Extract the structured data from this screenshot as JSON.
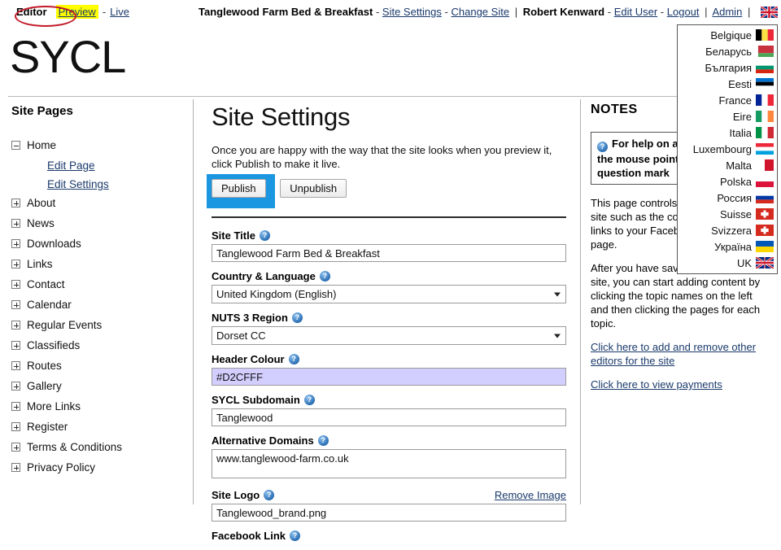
{
  "topbar": {
    "editor": "Editor",
    "preview": "Preview",
    "dash": "-",
    "live": "Live",
    "site_name": "Tanglewood Farm Bed & Breakfast",
    "dash2": "-",
    "site_settings": "Site Settings",
    "dash3": "-",
    "change_site": "Change Site",
    "pipe1": "|",
    "user_name": "Robert Kenward",
    "dash4": "-",
    "edit_user": "Edit User",
    "dash5": "-",
    "logout": "Logout",
    "pipe2": "|",
    "admin": "Admin",
    "pipe3": "|",
    "flag_icon": "uk-flag-icon"
  },
  "brand": {
    "logo_text": "SYCL"
  },
  "sidebar": {
    "heading": "Site Pages",
    "items": [
      {
        "label": "Home",
        "state": "expanded"
      },
      {
        "label": "About",
        "state": "collapsed"
      },
      {
        "label": "News",
        "state": "collapsed"
      },
      {
        "label": "Downloads",
        "state": "collapsed"
      },
      {
        "label": "Links",
        "state": "collapsed"
      },
      {
        "label": "Contact",
        "state": "collapsed"
      },
      {
        "label": "Calendar",
        "state": "collapsed"
      },
      {
        "label": "Regular Events",
        "state": "collapsed"
      },
      {
        "label": "Classifieds",
        "state": "collapsed"
      },
      {
        "label": "Routes",
        "state": "collapsed"
      },
      {
        "label": "Gallery",
        "state": "collapsed"
      },
      {
        "label": "More Links",
        "state": "collapsed"
      },
      {
        "label": "Register",
        "state": "collapsed"
      },
      {
        "label": "Terms & Conditions",
        "state": "collapsed"
      },
      {
        "label": "Privacy Policy",
        "state": "collapsed"
      }
    ],
    "home_sub": [
      {
        "label": "Edit Page"
      },
      {
        "label": "Edit Settings"
      }
    ]
  },
  "main": {
    "title": "Site Settings",
    "intro": "Once you are happy with the way that the site looks when you preview it, click Publish to make it live.",
    "publish_label": "Publish",
    "unpublish_label": "Unpublish",
    "fields": {
      "site_title": {
        "label": "Site Title",
        "value": "Tanglewood Farm Bed & Breakfast"
      },
      "country_language": {
        "label": "Country & Language",
        "value": "United Kingdom (English)"
      },
      "nuts3": {
        "label": "NUTS 3 Region",
        "value": "Dorset CC"
      },
      "header_colour": {
        "label": "Header Colour",
        "value": "#D2CFFF"
      },
      "sycl_subdomain": {
        "label": "SYCL Subdomain",
        "value": "Tanglewood"
      },
      "alternative_domains": {
        "label": "Alternative Domains",
        "value": "www.tanglewood-farm.co.uk"
      },
      "site_logo": {
        "label": "Site Logo",
        "value": "Tanglewood_brand.png",
        "remove_link": "Remove Image"
      },
      "facebook_link": {
        "label": "Facebook Link"
      }
    }
  },
  "notes": {
    "heading": "NOTES",
    "helpbox": "For help on any item, hold the mouse pointer over the question mark",
    "para1": "This page controls settings for your site such as the country, language and links to your Facebook and Twitter page.",
    "para2": "After you have saved details of your site, you can start adding content by clicking the topic names on the left and then clicking the pages for each topic.",
    "link1": "Click here to add and remove other editors for the site",
    "link2": "Click here to view payments"
  },
  "language_dropdown": {
    "items": [
      {
        "label": "Belgique",
        "flag": "belgium-flag-icon"
      },
      {
        "label": "Беларусь",
        "flag": "belarus-flag-icon"
      },
      {
        "label": "България",
        "flag": "bulgaria-flag-icon"
      },
      {
        "label": "Eesti",
        "flag": "estonia-flag-icon"
      },
      {
        "label": "France",
        "flag": "france-flag-icon"
      },
      {
        "label": "Eire",
        "flag": "ireland-flag-icon"
      },
      {
        "label": "Italia",
        "flag": "italy-flag-icon"
      },
      {
        "label": "Luxembourg",
        "flag": "luxembourg-flag-icon"
      },
      {
        "label": "Malta",
        "flag": "malta-flag-icon"
      },
      {
        "label": "Polska",
        "flag": "poland-flag-icon"
      },
      {
        "label": "Россия",
        "flag": "russia-flag-icon"
      },
      {
        "label": "Suisse",
        "flag": "switzerland-flag-icon"
      },
      {
        "label": "Svizzera",
        "flag": "switzerland-flag-icon"
      },
      {
        "label": "Україна",
        "flag": "ukraine-flag-icon"
      },
      {
        "label": "UK",
        "flag": "uk-flag-icon"
      }
    ]
  },
  "colors": {
    "highlight_blue": "#1B96E0",
    "annotation_red": "#C31A28",
    "preview_highlight": "#FFFF00",
    "header_colour_value": "#D2CFFF"
  }
}
